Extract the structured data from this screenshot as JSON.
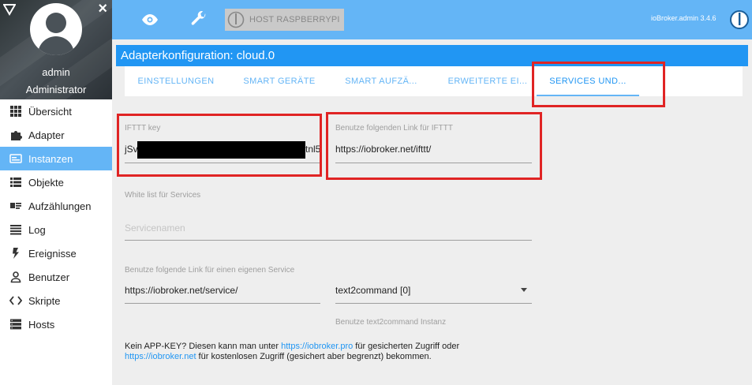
{
  "sidebar": {
    "user": "admin",
    "role": "Administrator",
    "items": [
      {
        "label": "Übersicht",
        "icon": "grid-icon",
        "active": false
      },
      {
        "label": "Adapter",
        "icon": "puzzle-icon",
        "active": false
      },
      {
        "label": "Instanzen",
        "icon": "instances-icon",
        "active": true
      },
      {
        "label": "Objekte",
        "icon": "list-icon",
        "active": false
      },
      {
        "label": "Aufzählungen",
        "icon": "enum-icon",
        "active": false
      },
      {
        "label": "Log",
        "icon": "log-icon",
        "active": false
      },
      {
        "label": "Ereignisse",
        "icon": "bolt-icon",
        "active": false
      },
      {
        "label": "Benutzer",
        "icon": "user-icon",
        "active": false
      },
      {
        "label": "Skripte",
        "icon": "code-icon",
        "active": false
      },
      {
        "label": "Hosts",
        "icon": "hosts-icon",
        "active": false
      }
    ]
  },
  "topbar": {
    "host_label": "HOST RASPBERRYPI",
    "version": "ioBroker.admin 3.4.6"
  },
  "page": {
    "title": "Adapterkonfiguration: cloud.0"
  },
  "tabs": [
    {
      "label": "EINSTELLUNGEN",
      "active": false
    },
    {
      "label": "SMART GERÄTE",
      "active": false
    },
    {
      "label": "SMART AUFZÄ...",
      "active": false
    },
    {
      "label": "ERWEITERTE EI...",
      "active": false
    },
    {
      "label": "SERVICES UND...",
      "active": true
    }
  ],
  "form": {
    "ifttt_key": {
      "label": "IFTTT key",
      "value_start": "jSv",
      "value_end": "tnl5"
    },
    "ifttt_link": {
      "label": "Benutze folgenden Link für IFTTT",
      "value": "https://iobroker.net/ifttt/"
    },
    "whitelist": {
      "label": "White list für Services",
      "placeholder": "Servicenamen"
    },
    "service_link": {
      "label": "Benutze folgende Link für einen eigenen Service",
      "value": "https://iobroker.net/service/"
    },
    "text2command": {
      "value": "text2command [0]",
      "helper": "Benutze text2command Instanz"
    }
  },
  "info": {
    "line1_text": "Kein APP-KEY? Diesen kann man unter ",
    "line1_link": "https://iobroker.pro",
    "line1_rest": " für gesicherten Zugriff oder",
    "line2_link": "https://iobroker.net",
    "line2_rest": " für kostenlosen Zugriff (gesichert aber begrenzt) bekommen."
  },
  "colors": {
    "accent": "#64b5f6",
    "title_bar": "#2196f3",
    "highlight": "#e02424"
  }
}
